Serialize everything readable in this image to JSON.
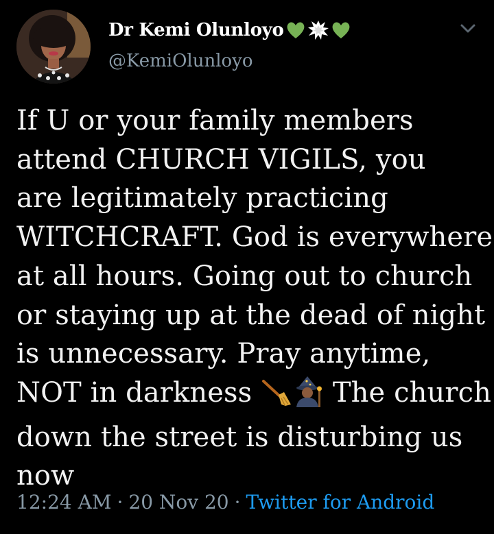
{
  "author": {
    "display_name": "Dr Kemi Olunloyo",
    "name_emojis": [
      "green-heart",
      "explosion",
      "green-heart"
    ],
    "handle": "@KemiOlunloyo"
  },
  "tweet": {
    "lines": [
      "If U or your family members",
      "attend CHURCH VIGILS, you",
      "are legitimately practicing",
      "WITCHCRAFT. God is everywhere",
      "at all hours. Going out to church",
      "or staying up at the dead of night",
      "is unnecessary. Pray anytime,",
      {
        "before": "NOT in darkness ",
        "emojis": [
          "broom",
          "mage"
        ],
        "after": " The church"
      },
      "down the street is disturbing us",
      "now"
    ]
  },
  "meta": {
    "time": "12:24 AM",
    "separator": "·",
    "date": "20 Nov 20",
    "source": "Twitter for Android"
  },
  "colors": {
    "background": "#000000",
    "text": "#f2f2f2",
    "secondary": "#8899a6",
    "link": "#1d9bf0",
    "green_heart": "#77b255"
  }
}
